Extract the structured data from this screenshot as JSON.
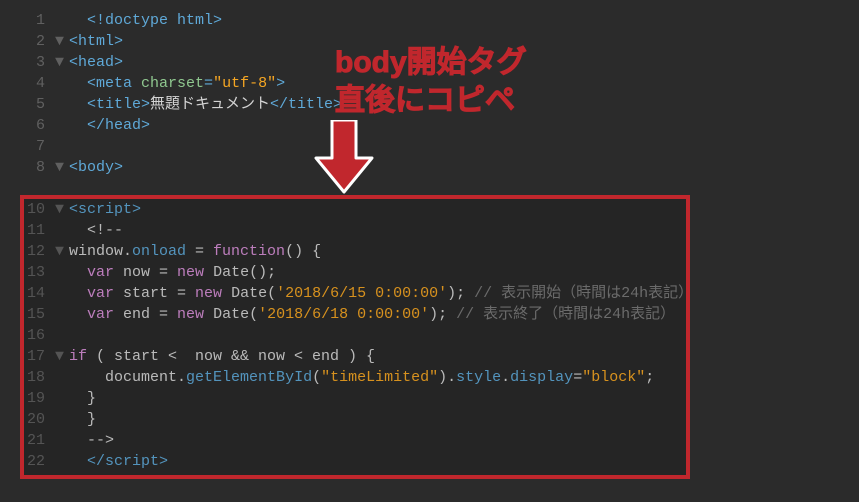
{
  "annotation": {
    "line1": "body開始タグ",
    "line2": "直後にコピペ"
  },
  "lines": [
    {
      "num": "1",
      "indent": 1,
      "tri": false,
      "tokens": [
        [
          "tag",
          "<!doctype html>"
        ]
      ]
    },
    {
      "num": "2",
      "indent": 0,
      "tri": true,
      "tokens": [
        [
          "tag",
          "<html>"
        ]
      ]
    },
    {
      "num": "3",
      "indent": 0,
      "tri": true,
      "tokens": [
        [
          "tag",
          "<head>"
        ]
      ]
    },
    {
      "num": "4",
      "indent": 1,
      "tri": false,
      "tokens": [
        [
          "tag",
          "<meta "
        ],
        [
          "attr",
          "charset"
        ],
        [
          "tag",
          "="
        ],
        [
          "str",
          "\"utf-8\""
        ],
        [
          "tag",
          ">"
        ]
      ]
    },
    {
      "num": "5",
      "indent": 1,
      "tri": false,
      "tokens": [
        [
          "tag",
          "<title>"
        ],
        [
          "op",
          "無題ドキュメント"
        ],
        [
          "tag",
          "</title>"
        ]
      ]
    },
    {
      "num": "6",
      "indent": 1,
      "tri": false,
      "tokens": [
        [
          "tag",
          "</head>"
        ]
      ]
    },
    {
      "num": "7",
      "indent": 0,
      "tri": false,
      "tokens": []
    },
    {
      "num": "8",
      "indent": 0,
      "tri": true,
      "tokens": [
        [
          "tag",
          "<body>"
        ]
      ]
    },
    {
      "num": "",
      "indent": 0,
      "tri": false,
      "tokens": []
    },
    {
      "num": "10",
      "indent": 0,
      "tri": true,
      "tokens": [
        [
          "tag",
          "<script>"
        ]
      ]
    },
    {
      "num": "11",
      "indent": 1,
      "tri": false,
      "tokens": [
        [
          "op",
          "<!--"
        ]
      ]
    },
    {
      "num": "12",
      "indent": 0,
      "tri": true,
      "tokens": [
        [
          "op",
          "window."
        ],
        [
          "fn",
          "onload"
        ],
        [
          "op",
          " = "
        ],
        [
          "kw",
          "function"
        ],
        [
          "op",
          "() {"
        ]
      ]
    },
    {
      "num": "13",
      "indent": 1,
      "tri": false,
      "tokens": [
        [
          "kw",
          "var"
        ],
        [
          "op",
          " now = "
        ],
        [
          "kw",
          "new"
        ],
        [
          "op",
          " Date();"
        ]
      ]
    },
    {
      "num": "14",
      "indent": 1,
      "tri": false,
      "tokens": [
        [
          "kw",
          "var"
        ],
        [
          "op",
          " start = "
        ],
        [
          "kw",
          "new"
        ],
        [
          "op",
          " Date("
        ],
        [
          "str",
          "'2018/6/15 0:00:00'"
        ],
        [
          "op",
          ");"
        ],
        [
          "cmt",
          " // 表示開始（時間は24h表記）"
        ]
      ]
    },
    {
      "num": "15",
      "indent": 1,
      "tri": false,
      "tokens": [
        [
          "kw",
          "var"
        ],
        [
          "op",
          " end = "
        ],
        [
          "kw",
          "new"
        ],
        [
          "op",
          " Date("
        ],
        [
          "str",
          "'2018/6/18 0:00:00'"
        ],
        [
          "op",
          ");"
        ],
        [
          "cmt",
          " // 表示終了（時間は24h表記）"
        ]
      ]
    },
    {
      "num": "16",
      "indent": 0,
      "tri": false,
      "tokens": []
    },
    {
      "num": "17",
      "indent": 0,
      "tri": true,
      "tokens": [
        [
          "kw",
          "if"
        ],
        [
          "op",
          " ( start <  now && now < end ) {"
        ]
      ]
    },
    {
      "num": "18",
      "indent": 2,
      "tri": false,
      "tokens": [
        [
          "op",
          "document."
        ],
        [
          "fn",
          "getElementById"
        ],
        [
          "op",
          "("
        ],
        [
          "str",
          "\"timeLimited\""
        ],
        [
          "op",
          ")."
        ],
        [
          "fn",
          "style"
        ],
        [
          "op",
          "."
        ],
        [
          "fn",
          "display"
        ],
        [
          "op",
          "="
        ],
        [
          "str",
          "\"block\""
        ],
        [
          "op",
          ";"
        ]
      ]
    },
    {
      "num": "19",
      "indent": 1,
      "tri": false,
      "tokens": [
        [
          "op",
          "}"
        ]
      ]
    },
    {
      "num": "20",
      "indent": 1,
      "tri": false,
      "tokens": [
        [
          "op",
          "}"
        ]
      ]
    },
    {
      "num": "21",
      "indent": 1,
      "tri": false,
      "tokens": [
        [
          "op",
          "-->"
        ]
      ]
    },
    {
      "num": "22",
      "indent": 1,
      "tri": false,
      "tokens": [
        [
          "tag",
          "</script>"
        ]
      ]
    }
  ]
}
